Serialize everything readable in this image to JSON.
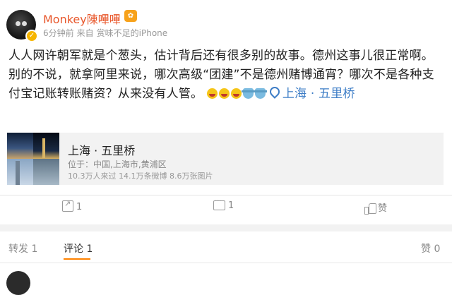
{
  "post": {
    "username": "Monkey陳嗶嗶",
    "vip_badge": "✿",
    "time_ago": "6分钟前",
    "source_prefix": "来自",
    "source": "赏味不足的iPhone",
    "text": "人人网许朝军就是个葱头，估计背后还有很多别的故事。德州这事儿很正常啊。别的不说，就拿阿里来说，哪次高级“团建”不是德州赌博通宵？哪次不是各种支付宝记账转账赌资？从来没有人管。",
    "location_tag": "上海 · 五里桥",
    "emojis": [
      "laugh",
      "laugh",
      "laugh",
      "pot",
      "pot"
    ]
  },
  "location_card": {
    "name": "上海 · 五里桥",
    "address": "位于：中国,上海市,黄浦区",
    "stats": "10.3万人来过 14.1万条微博 8.6万张图片"
  },
  "actions": {
    "repost_count": "1",
    "comment_count": "1",
    "like_label": "赞"
  },
  "tabs": {
    "repost": "转发 1",
    "comment": "评论 1",
    "like": "赞 0"
  },
  "colors": {
    "username": "#e8562a",
    "link": "#3d7dc6",
    "tab_indicator": "#ff8200"
  }
}
